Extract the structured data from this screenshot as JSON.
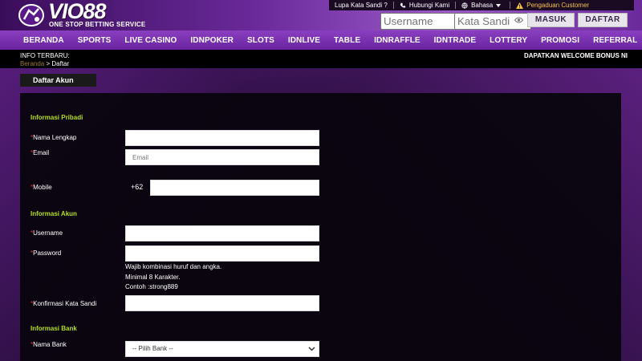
{
  "brand": {
    "logo_text": "VIO88",
    "tagline": "ONE STOP BETTING SERVICE"
  },
  "topbar": {
    "forgot": "Lupa Kata Sandi ?",
    "contact": "Hubungi Kami",
    "language": "Bahasa",
    "complaint": "Pengaduan Customer"
  },
  "login": {
    "username_placeholder": "Username",
    "password_placeholder": "Kata Sandi",
    "login_label": "MASUK",
    "register_label": "DAFTAR"
  },
  "nav": {
    "items": [
      "BERANDA",
      "SPORTS",
      "LIVE CASINO",
      "IDNPOKER",
      "SLOTS",
      "IDNLIVE",
      "TABLE",
      "IDNRAFFLE",
      "IDNTRADE",
      "LOTTERY",
      "PROMOSI",
      "REFERRAL"
    ]
  },
  "infobar": {
    "label": "INFO TERBARU:",
    "breadcrumb_home": "Beranda",
    "breadcrumb_sep": " > ",
    "breadcrumb_current": "Daftar",
    "marquee": "DAPATKAN WELCOME BONUS NI"
  },
  "page": {
    "tab": "Daftar Akun"
  },
  "form": {
    "required_mark": "*",
    "section_personal": "Informasi Pribadi",
    "full_name_label": "Nama Lengkap",
    "email_label": "Email",
    "email_placeholder": "Email",
    "mobile_label": "Mobile",
    "mobile_prefix": "+62",
    "section_account": "Informasi Akun",
    "username_label": "Username",
    "password_label": "Password",
    "password_hint_1": "Wajib kombinasi huruf dan angka.",
    "password_hint_2": "Minimal 8 Karakter.",
    "password_hint_3": "Contoh :strong889",
    "confirm_label": "Konfirmasi Kata Sandi",
    "section_bank": "Informasi Bank",
    "bank_name_label": "Nama Bank",
    "bank_select_value": "-- Pilih Bank --"
  },
  "colors": {
    "section_accent": "#b5e020",
    "required": "#e23333",
    "warning": "#f5c542",
    "nav_bg": "#7a30b0"
  }
}
